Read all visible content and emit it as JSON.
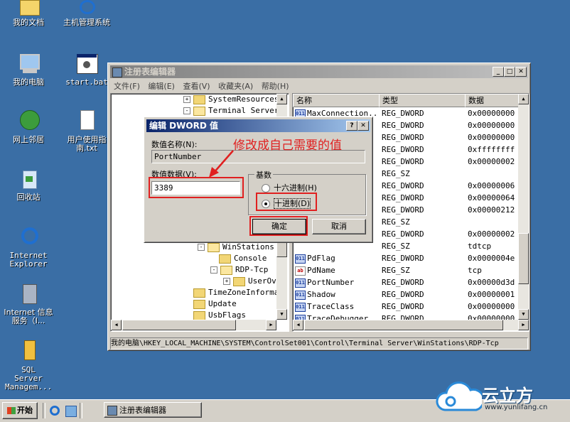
{
  "desktop": {
    "icons": [
      {
        "label": "我的文档"
      },
      {
        "label": "主机管理系统"
      },
      {
        "label": "我的电脑"
      },
      {
        "label": "start.bat"
      },
      {
        "label": "网上邻居"
      },
      {
        "label": "用户使用指南.txt"
      },
      {
        "label": "回收站"
      },
      {
        "label": "Internet Explorer"
      },
      {
        "label": "Internet 信息服务（I..."
      },
      {
        "label": "SQL Server Managem..."
      }
    ]
  },
  "regedit": {
    "title": "注册表编辑器",
    "menu": [
      "文件(F)",
      "编辑(E)",
      "查看(V)",
      "收藏夹(A)",
      "帮助(H)"
    ],
    "tree": [
      {
        "label": "SystemResources",
        "expander": "+"
      },
      {
        "label": "Terminal Server",
        "expander": "-"
      },
      {
        "label": "WinStations",
        "expander": "-"
      },
      {
        "label": "Console",
        "expander": ""
      },
      {
        "label": "RDP-Tcp",
        "expander": "-"
      },
      {
        "label": "UserOv",
        "expander": "+"
      },
      {
        "label": "TimeZoneInformat",
        "expander": ""
      },
      {
        "label": "Update",
        "expander": ""
      },
      {
        "label": "UsbFlags",
        "expander": ""
      }
    ],
    "columns": [
      "名称",
      "类型",
      "数据"
    ],
    "rows": [
      {
        "name": "MaxConnection...",
        "type": "REG_DWORD",
        "data": "0x00000000",
        "icon": "dword"
      },
      {
        "name": "",
        "type": "REG_DWORD",
        "data": "0x00000000",
        "icon": ""
      },
      {
        "name": "",
        "type": "REG_DWORD",
        "data": "0x00000000",
        "icon": ""
      },
      {
        "name": "",
        "type": "REG_DWORD",
        "data": "0xffffffff",
        "icon": ""
      },
      {
        "name": "",
        "type": "REG_DWORD",
        "data": "0x00000002",
        "icon": ""
      },
      {
        "name": "",
        "type": "REG_SZ",
        "data": "",
        "icon": ""
      },
      {
        "name": "",
        "type": "REG_DWORD",
        "data": "0x00000006",
        "icon": ""
      },
      {
        "name": "",
        "type": "REG_DWORD",
        "data": "0x00000064",
        "icon": ""
      },
      {
        "name": "",
        "type": "REG_DWORD",
        "data": "0x00000212",
        "icon": ""
      },
      {
        "name": "",
        "type": "REG_SZ",
        "data": "",
        "icon": ""
      },
      {
        "name": "",
        "type": "REG_DWORD",
        "data": "0x00000002",
        "icon": ""
      },
      {
        "name": "",
        "type": "REG_SZ",
        "data": "tdtcp",
        "icon": ""
      },
      {
        "name": "PdFlag",
        "type": "REG_DWORD",
        "data": "0x0000004e",
        "icon": "dword"
      },
      {
        "name": "PdName",
        "type": "REG_SZ",
        "data": "tcp",
        "icon": "sz"
      },
      {
        "name": "PortNumber",
        "type": "REG_DWORD",
        "data": "0x00000d3d",
        "icon": "dword"
      },
      {
        "name": "Shadow",
        "type": "REG_DWORD",
        "data": "0x00000001",
        "icon": "dword"
      },
      {
        "name": "TraceClass",
        "type": "REG_DWORD",
        "data": "0x00000000",
        "icon": "dword"
      },
      {
        "name": "TraceDebugger",
        "type": "REG_DWORD",
        "data": "0x00000000",
        "icon": "dword"
      }
    ],
    "statusbar": "我的电脑\\HKEY_LOCAL_MACHINE\\SYSTEM\\ControlSet001\\Control\\Terminal Server\\WinStations\\RDP-Tcp"
  },
  "dialog": {
    "title": "编辑 DWORD 值",
    "name_label": "数值名称(N):",
    "name_value": "PortNumber",
    "data_label": "数值数据(V):",
    "data_value": "3389",
    "base_label": "基数",
    "radio_hex": "十六进制(H)",
    "radio_dec": "十进制(D)",
    "selected_base": "decimal",
    "ok": "确定",
    "cancel": "取消"
  },
  "annotation": {
    "text": "修改成自己需要的值",
    "color": "#e02020"
  },
  "taskbar": {
    "start": "开始",
    "task": "注册表编辑器"
  },
  "watermark": {
    "brand": "云立方",
    "url": "www.yunlifang.cn"
  }
}
